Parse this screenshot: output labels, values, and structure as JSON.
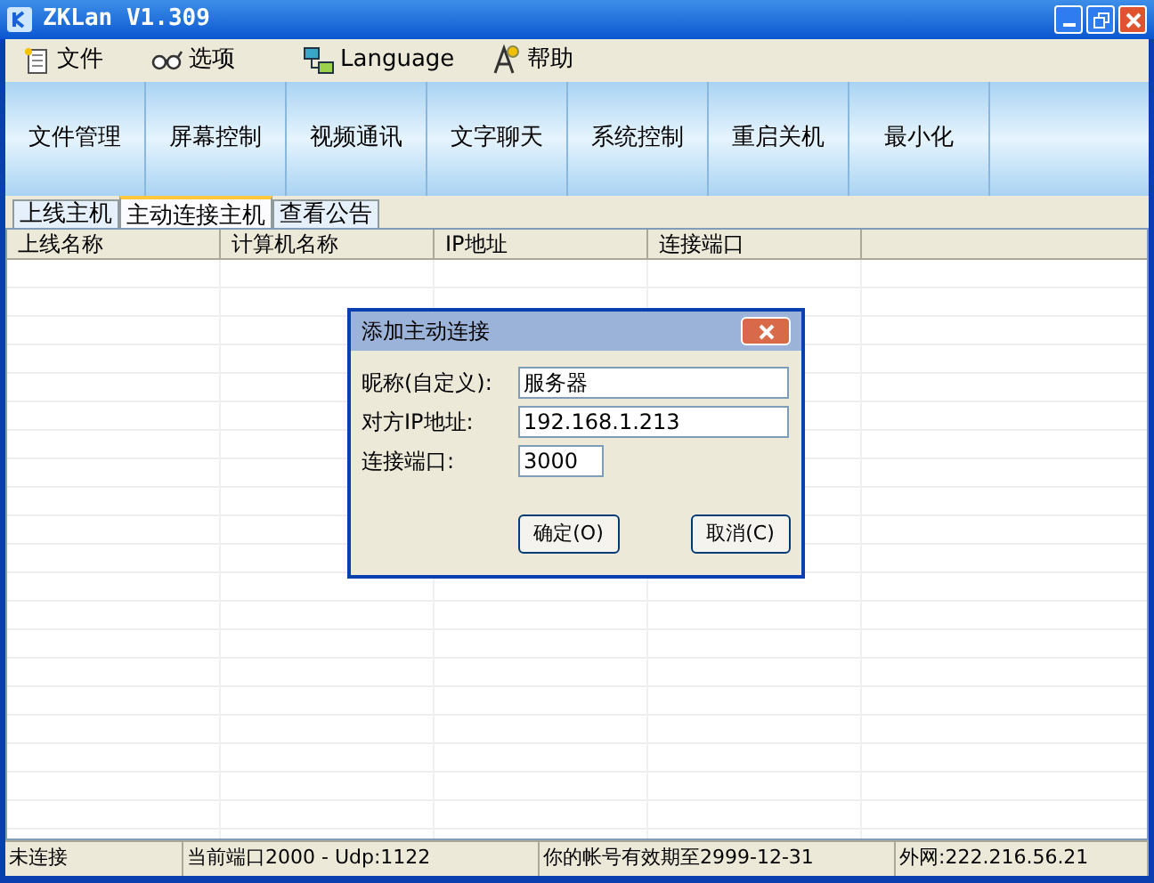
{
  "window": {
    "title": "ZKLan V1.309"
  },
  "menu": [
    "文件",
    "选项",
    "Language",
    "帮助"
  ],
  "toolbar": [
    "文件管理",
    "屏幕控制",
    "视频通讯",
    "文字聊天",
    "系统控制",
    "重启关机",
    "最小化"
  ],
  "tabs": [
    {
      "label": "上线主机",
      "selected": false
    },
    {
      "label": "主动连接主机",
      "selected": true
    },
    {
      "label": "查看公告",
      "selected": false
    }
  ],
  "table": {
    "columns": [
      "上线名称",
      "计算机名称",
      "IP地址",
      "连接端口"
    ]
  },
  "dialog": {
    "title": "添加主动连接",
    "fields": [
      {
        "label": "昵称(自定义):",
        "value": "服务器"
      },
      {
        "label": "对方IP地址:",
        "value": "192.168.1.213"
      },
      {
        "label": "连接端口:",
        "value": "3000"
      }
    ],
    "buttons": [
      "确定(O)",
      "取消(C)"
    ]
  },
  "status_bar": [
    "未连接",
    "当前端口2000 - Udp:1122",
    "你的帐号有效期至2999-12-31",
    "外网:222.216.56.21"
  ]
}
